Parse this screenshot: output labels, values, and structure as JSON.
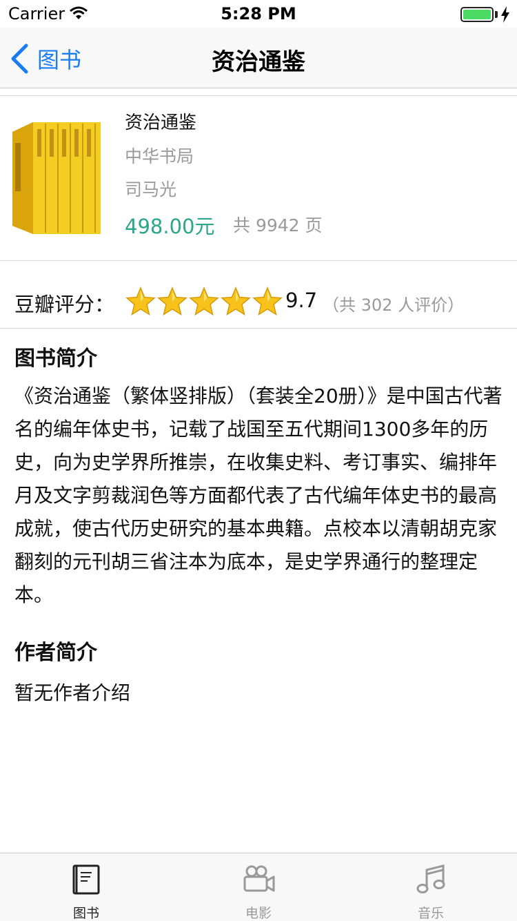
{
  "status_bar": {
    "carrier": "Carrier",
    "time": "5:28 PM",
    "battery_level": 1.0
  },
  "nav": {
    "back_label": "图书",
    "title": "资治通鉴"
  },
  "book": {
    "title": "资治通鉴",
    "publisher": "中华书局",
    "author": "司马光",
    "price": "498.00元",
    "pages": "共 9942 页"
  },
  "rating": {
    "label": "豆瓣评分：",
    "stars": 5,
    "score": "9.7",
    "count": "（共 302 人评价）"
  },
  "book_intro": {
    "title": "图书简介",
    "body": "《资治通鉴（繁体竖排版）（套装全20册）》是中国古代著名的编年体史书，记载了战国至五代期间1300多年的历史，向为史学界所推崇，在收集史料、考订事实、编排年月及文字剪裁润色等方面都代表了古代编年体史书的最高成就，使古代历史研究的基本典籍。点校本以清朝胡克家翻刻的元刊胡三省注本为底本，是史学界通行的整理定本。"
  },
  "author_intro": {
    "title": "作者简介",
    "body": "暂无作者介绍"
  },
  "tabs": [
    {
      "label": "图书",
      "icon": "book-icon",
      "active": true
    },
    {
      "label": "电影",
      "icon": "video-camera-icon",
      "active": false
    },
    {
      "label": "音乐",
      "icon": "music-note-icon",
      "active": false
    }
  ],
  "colors": {
    "accent": "#1a7cf5",
    "price": "#2aa68a",
    "muted": "#9a9a9a",
    "star": "#f7c21a",
    "tab_active": "#222222",
    "tab_inactive": "#999999"
  }
}
